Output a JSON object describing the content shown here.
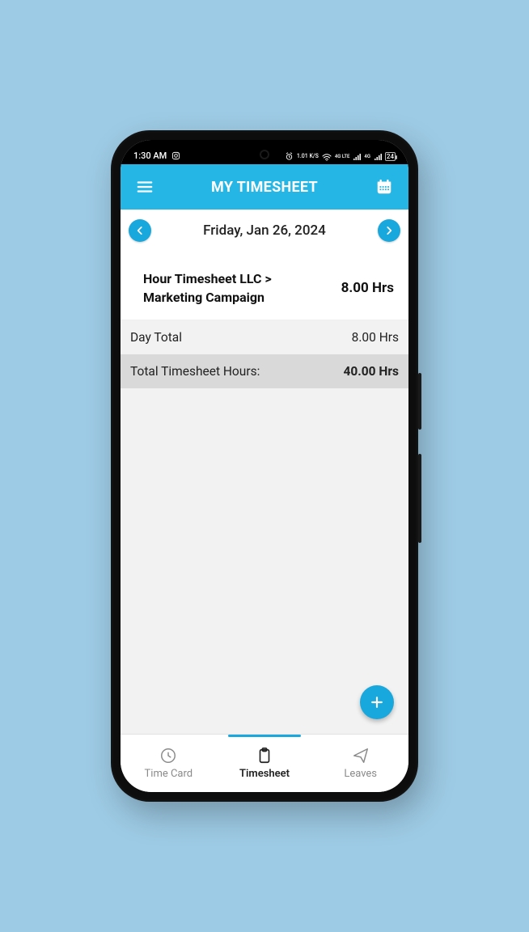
{
  "statusbar": {
    "time": "1:30 AM",
    "battery": "24",
    "net_speed": "1.01 K/S",
    "net1": "4G LTE",
    "net2": "4G"
  },
  "appbar": {
    "title": "MY TIMESHEET"
  },
  "date": {
    "label": "Friday, Jan 26, 2024"
  },
  "entry": {
    "title": "Hour Timesheet LLC > Marketing Campaign",
    "hours": "8.00 Hrs"
  },
  "summary": {
    "day_total_label": "Day Total",
    "day_total_value": "8.00 Hrs",
    "total_label": "Total Timesheet Hours:",
    "total_value": "40.00 Hrs"
  },
  "tabs": {
    "timecard": "Time Card",
    "timesheet": "Timesheet",
    "leaves": "Leaves"
  }
}
